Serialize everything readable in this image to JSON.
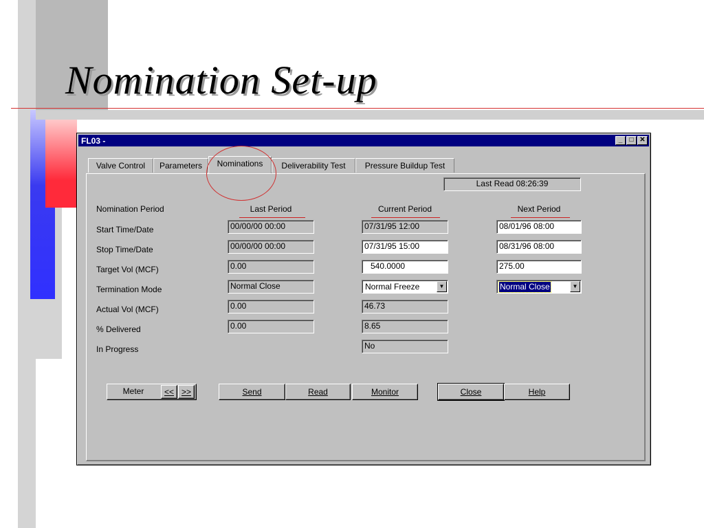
{
  "slide": {
    "title": "Nomination  Set-up"
  },
  "window": {
    "title": "FL03     -"
  },
  "tabs": [
    "Valve Control",
    "Parameters",
    "Nominations",
    "Deliverability Test",
    "Pressure Buildup Test"
  ],
  "last_read": "Last Read 08:26:39",
  "headers": {
    "row_label": "Nomination Period",
    "last": "Last Period",
    "current": "Current Period",
    "next": "Next Period"
  },
  "rows": {
    "start": {
      "label": "Start Time/Date",
      "last": "00/00/00 00:00",
      "current": "07/31/95 12:00",
      "next": "08/01/96 08:00"
    },
    "stop": {
      "label": "Stop Time/Date",
      "last": "00/00/00 00:00",
      "current": "07/31/95 15:00",
      "next": "08/31/96 08:00"
    },
    "target": {
      "label": "Target Vol (MCF)",
      "last": "0.00",
      "current": "540.0000",
      "next": "275.00"
    },
    "termination": {
      "label": "Termination Mode",
      "last": "Normal Close",
      "current": "Normal Freeze",
      "next": "Normal Close"
    },
    "actual": {
      "label": "Actual Vol (MCF)",
      "last": "0.00",
      "current": "46.73"
    },
    "delivered": {
      "label": "% Delivered",
      "last": "0.00",
      "current": "8.65"
    },
    "progress": {
      "label": "In Progress",
      "current": "No"
    }
  },
  "buttons": {
    "meter": "Meter",
    "prev": "<<",
    "next": ">>",
    "send": "Send",
    "read": "Read",
    "monitor": "Monitor",
    "close": "Close",
    "help": "Help"
  },
  "colors": {
    "title_bar": "#000080",
    "accent_red": "#cc2020",
    "deco_blue": "#3a3af0",
    "deco_red": "#ff2a3a"
  }
}
